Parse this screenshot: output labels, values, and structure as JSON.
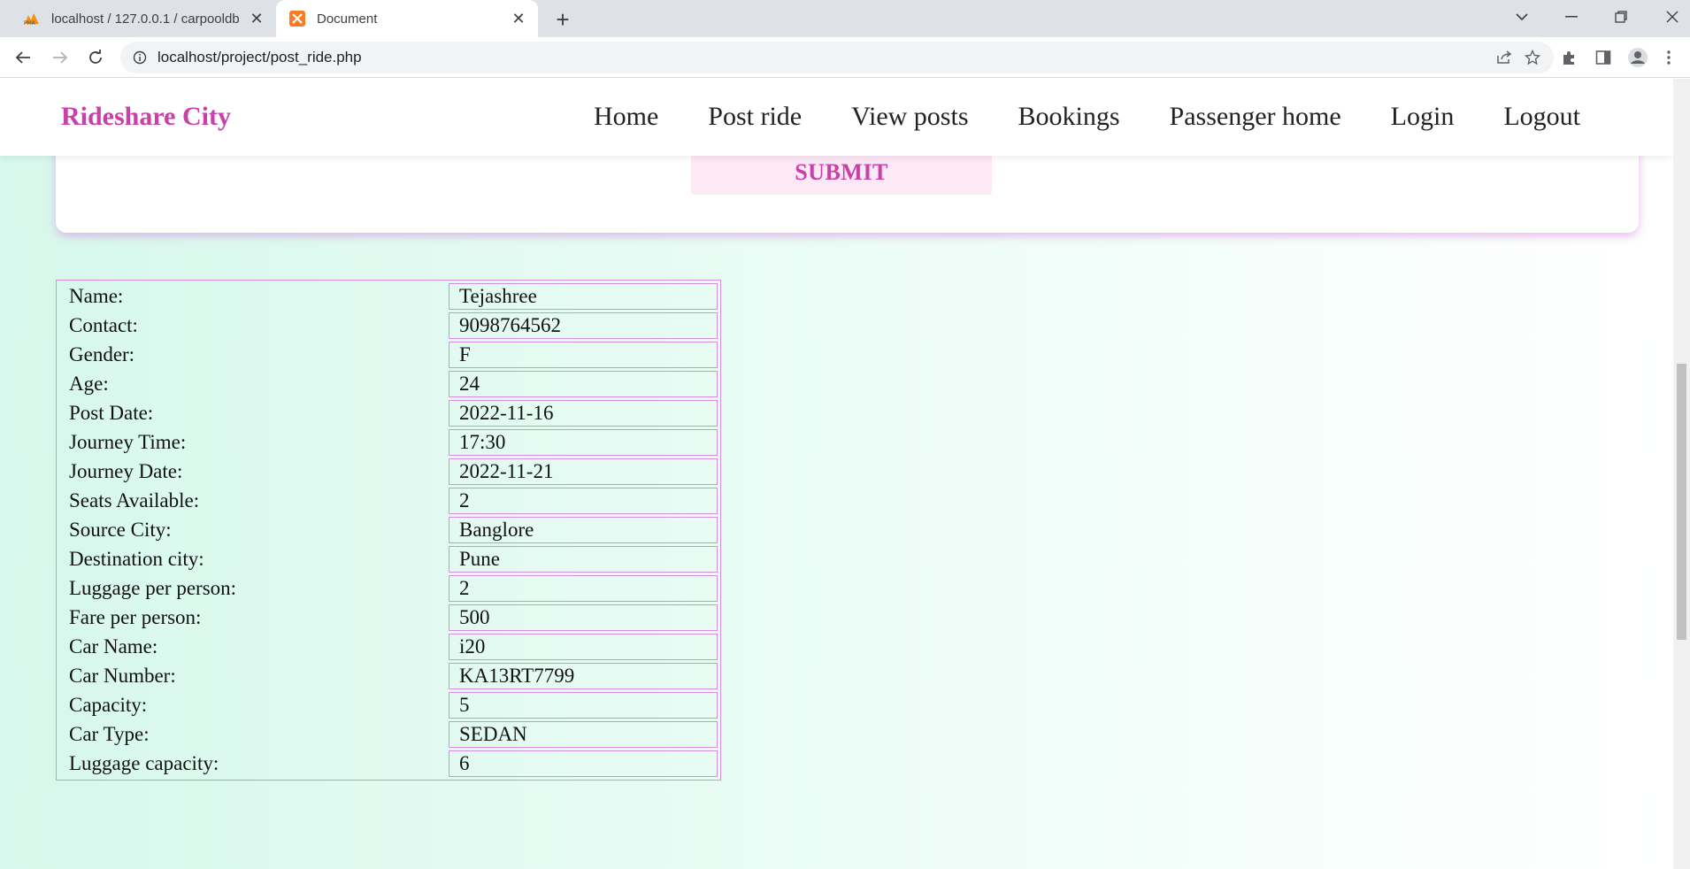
{
  "browser": {
    "tabs": [
      {
        "title": "localhost / 127.0.0.1 / carpooldb",
        "icon": "phpmyadmin-icon",
        "active": false
      },
      {
        "title": "Document",
        "icon": "xampp-icon",
        "active": true
      }
    ],
    "address_bar": {
      "url": "localhost/project/post_ride.php"
    }
  },
  "site": {
    "brand": "Rideshare City",
    "brand_color": "#c840a8",
    "nav": [
      "Home",
      "Post ride",
      "View posts",
      "Bookings",
      "Passenger home",
      "Login",
      "Logout"
    ]
  },
  "form": {
    "submit_label": "SUBMIT"
  },
  "details": [
    {
      "label": "Name:",
      "value": "Tejashree"
    },
    {
      "label": "Contact:",
      "value": "9098764562"
    },
    {
      "label": "Gender:",
      "value": "F"
    },
    {
      "label": "Age:",
      "value": "24"
    },
    {
      "label": "Post Date:",
      "value": "2022-11-16"
    },
    {
      "label": "Journey Time:",
      "value": "17:30"
    },
    {
      "label": "Journey Date:",
      "value": "2022-11-21"
    },
    {
      "label": "Seats Available:",
      "value": "2"
    },
    {
      "label": "Source City:",
      "value": "Banglore"
    },
    {
      "label": "Destination city:",
      "value": "Pune"
    },
    {
      "label": "Luggage per person:",
      "value": "2"
    },
    {
      "label": "Fare per person:",
      "value": "500"
    },
    {
      "label": "Car Name:",
      "value": "i20"
    },
    {
      "label": "Car Number:",
      "value": "KA13RT7799"
    },
    {
      "label": "Capacity:",
      "value": "5"
    },
    {
      "label": "Car Type:",
      "value": "SEDAN"
    },
    {
      "label": "Luggage capacity:",
      "value": "6"
    }
  ]
}
